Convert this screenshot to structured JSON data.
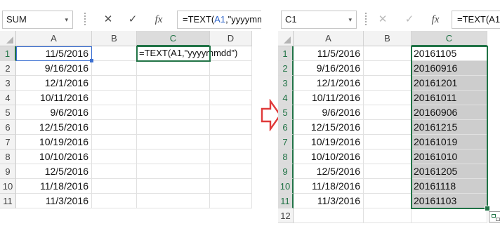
{
  "left": {
    "name_box": "SUM",
    "formula_text": "=TEXT(A1,\"yyyymm",
    "formula_ref": "A1",
    "columns": [
      "A",
      "B",
      "C",
      "D"
    ],
    "rows": [
      "1",
      "2",
      "3",
      "4",
      "5",
      "6",
      "7",
      "8",
      "9",
      "10",
      "11"
    ],
    "dates": [
      "11/5/2016",
      "9/16/2016",
      "12/1/2016",
      "10/11/2016",
      "9/6/2016",
      "12/15/2016",
      "10/19/2016",
      "10/10/2016",
      "12/5/2016",
      "11/18/2016",
      "11/3/2016"
    ],
    "c1_edit": "=TEXT(A1,\"yyyymmdd\")"
  },
  "right": {
    "name_box": "C1",
    "formula_text": "=TEXT(A1,",
    "columns": [
      "A",
      "B",
      "C"
    ],
    "rows": [
      "1",
      "2",
      "3",
      "4",
      "5",
      "6",
      "7",
      "8",
      "9",
      "10",
      "11",
      "12"
    ],
    "dates": [
      "11/5/2016",
      "9/16/2016",
      "12/1/2016",
      "10/11/2016",
      "9/6/2016",
      "12/15/2016",
      "10/19/2016",
      "10/10/2016",
      "12/5/2016",
      "11/18/2016",
      "11/3/2016"
    ],
    "results": [
      "20161105",
      "20160916",
      "20161201",
      "20161011",
      "20160906",
      "20161215",
      "20161019",
      "20161010",
      "20161205",
      "20161118",
      "20161103"
    ]
  },
  "icons": {
    "cancel": "✕",
    "enter": "✓",
    "fx": "fx",
    "dropdown": "▾"
  },
  "colors": {
    "accent_green": "#217346",
    "arrow_red": "#e03a3a",
    "ref_blue": "#3b6fd1"
  }
}
